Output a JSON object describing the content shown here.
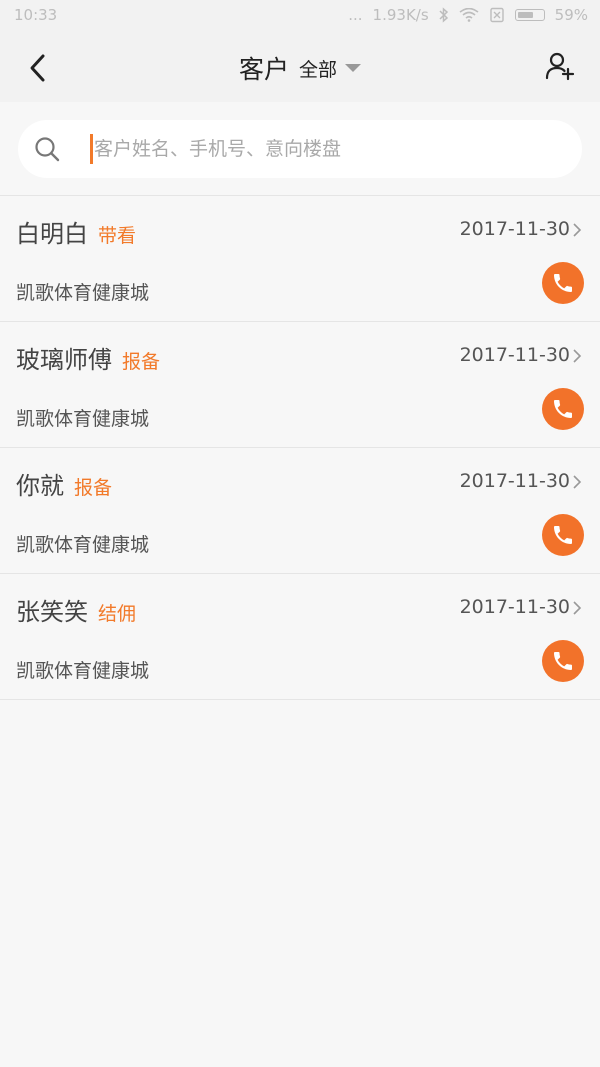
{
  "status_bar": {
    "time": "10:33",
    "signal_dots": "...",
    "network_speed": "1.93K/s",
    "battery": "59%"
  },
  "header": {
    "title": "客户",
    "filter_label": "全部"
  },
  "search": {
    "placeholder": "客户姓名、手机号、意向楼盘",
    "value": ""
  },
  "customers": [
    {
      "name": "白明白",
      "tag": "带看",
      "date": "2017-11-30",
      "project": "凯歌体育健康城"
    },
    {
      "name": "玻璃师傅",
      "tag": "报备",
      "date": "2017-11-30",
      "project": "凯歌体育健康城"
    },
    {
      "name": "你就",
      "tag": "报备",
      "date": "2017-11-30",
      "project": "凯歌体育健康城"
    },
    {
      "name": "张笑笑",
      "tag": "结佣",
      "date": "2017-11-30",
      "project": "凯歌体育健康城"
    }
  ],
  "colors": {
    "accent": "#f2722a",
    "header_bg": "#f2f2f2",
    "page_bg": "#f7f7f7"
  },
  "icons": {
    "back": "chevron-left-icon",
    "add_user": "add-user-icon",
    "search": "search-icon",
    "row_chevron": "chevron-right-icon",
    "call": "phone-icon"
  }
}
